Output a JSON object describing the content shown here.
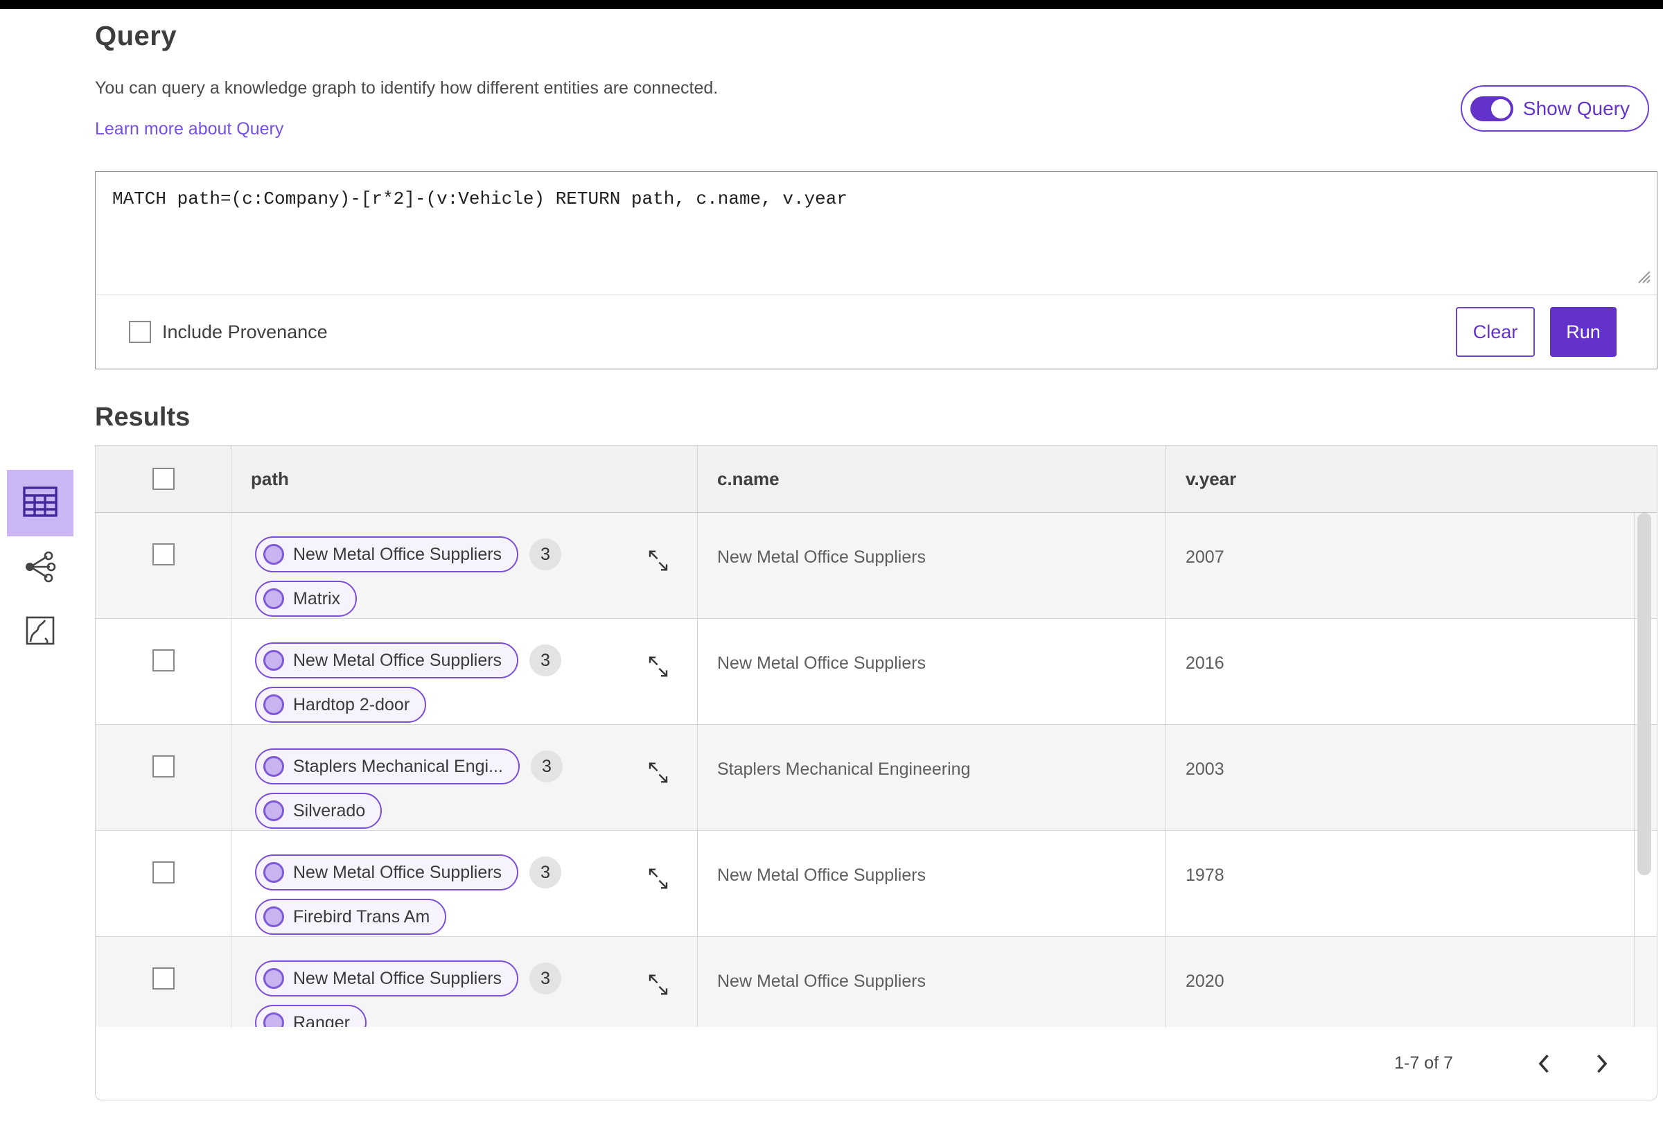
{
  "header": {
    "title": "Query",
    "description": "You can query a knowledge graph to identify how different entities are connected.",
    "learn_more": "Learn more about Query",
    "show_query_label": "Show Query",
    "show_query_state": "on"
  },
  "query_editor": {
    "query": "MATCH path=(c:Company)-[r*2]-(v:Vehicle) RETURN path, c.name, v.year",
    "include_provenance_label": "Include Provenance",
    "include_provenance_checked": "unchecked",
    "clear_label": "Clear",
    "run_label": "Run"
  },
  "results": {
    "title": "Results",
    "columns": {
      "path": "path",
      "c_name": "c.name",
      "v_year": "v.year"
    },
    "view_switcher": [
      "table-view-icon",
      "network-view-icon",
      "sketch-view-icon"
    ],
    "rows": [
      {
        "path_start": "New Metal Office Suppliers",
        "path_count": "3",
        "path_end": "Matrix",
        "c_name": "New Metal Office Suppliers",
        "v_year": "2007"
      },
      {
        "path_start": "New Metal Office Suppliers",
        "path_count": "3",
        "path_end": "Hardtop 2-door",
        "c_name": "New Metal Office Suppliers",
        "v_year": "2016"
      },
      {
        "path_start": "Staplers Mechanical Engi...",
        "path_count": "3",
        "path_end": "Silverado",
        "c_name": "Staplers Mechanical Engineering",
        "v_year": "2003"
      },
      {
        "path_start": "New Metal Office Suppliers",
        "path_count": "3",
        "path_end": "Firebird Trans Am",
        "c_name": "New Metal Office Suppliers",
        "v_year": "1978"
      },
      {
        "path_start": "New Metal Office Suppliers",
        "path_count": "3",
        "path_end": "Ranger",
        "c_name": "New Metal Office Suppliers",
        "v_year": "2020"
      }
    ],
    "pagination": {
      "range": "1-7 of 7"
    }
  },
  "colors": {
    "primary_purple": "#6333c9",
    "link_purple": "#7650e2",
    "pill_border": "#7a4fd8",
    "pill_bg": "#f6f3fd",
    "node_fill": "#c9b4f0",
    "selected_tile_bg": "#cbb6f4",
    "selected_tile_icon": "#43299c",
    "badge_bg": "#e3e3e3",
    "header_bg": "#f1f1f1",
    "alt_row_bg": "#f5f5f5",
    "table_border": "#d6d6d6"
  }
}
